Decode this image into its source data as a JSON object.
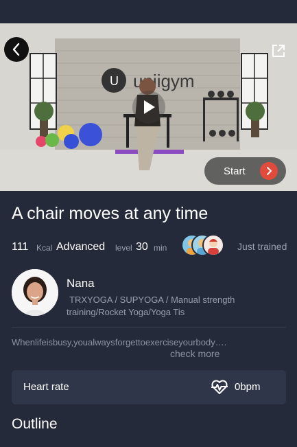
{
  "video": {
    "brand_text": "uniigym",
    "start_label": "Start"
  },
  "course": {
    "title": "A chair moves at any time",
    "kcal_value": "111",
    "kcal_unit": "Kcal",
    "difficulty": "Advanced",
    "level_unit": "level",
    "duration_value": "30",
    "duration_unit": "min",
    "just_trained": "Just trained"
  },
  "coach": {
    "name": "Nana",
    "tags": "TRXYOGA / SUPYOGA / Manual strength training/Rocket Yoga/Yoga Tis"
  },
  "description": {
    "text": "Whenlifeisbusy,youalwaysforgettoexerciseyourbody….",
    "more_label": "check more"
  },
  "heart_rate": {
    "label": "Heart rate",
    "value": "0bpm"
  },
  "section": {
    "outline_label": "Outline"
  },
  "icons": {
    "back": "chevron-left-icon",
    "share": "share-icon",
    "play": "play-icon",
    "start_arrow": "chevron-right-icon",
    "heart_rate": "heartbeat-icon"
  },
  "colors": {
    "background": "#252a3a",
    "card": "#30364a",
    "accent": "#e24a3b",
    "muted_text": "#9a9fae"
  }
}
